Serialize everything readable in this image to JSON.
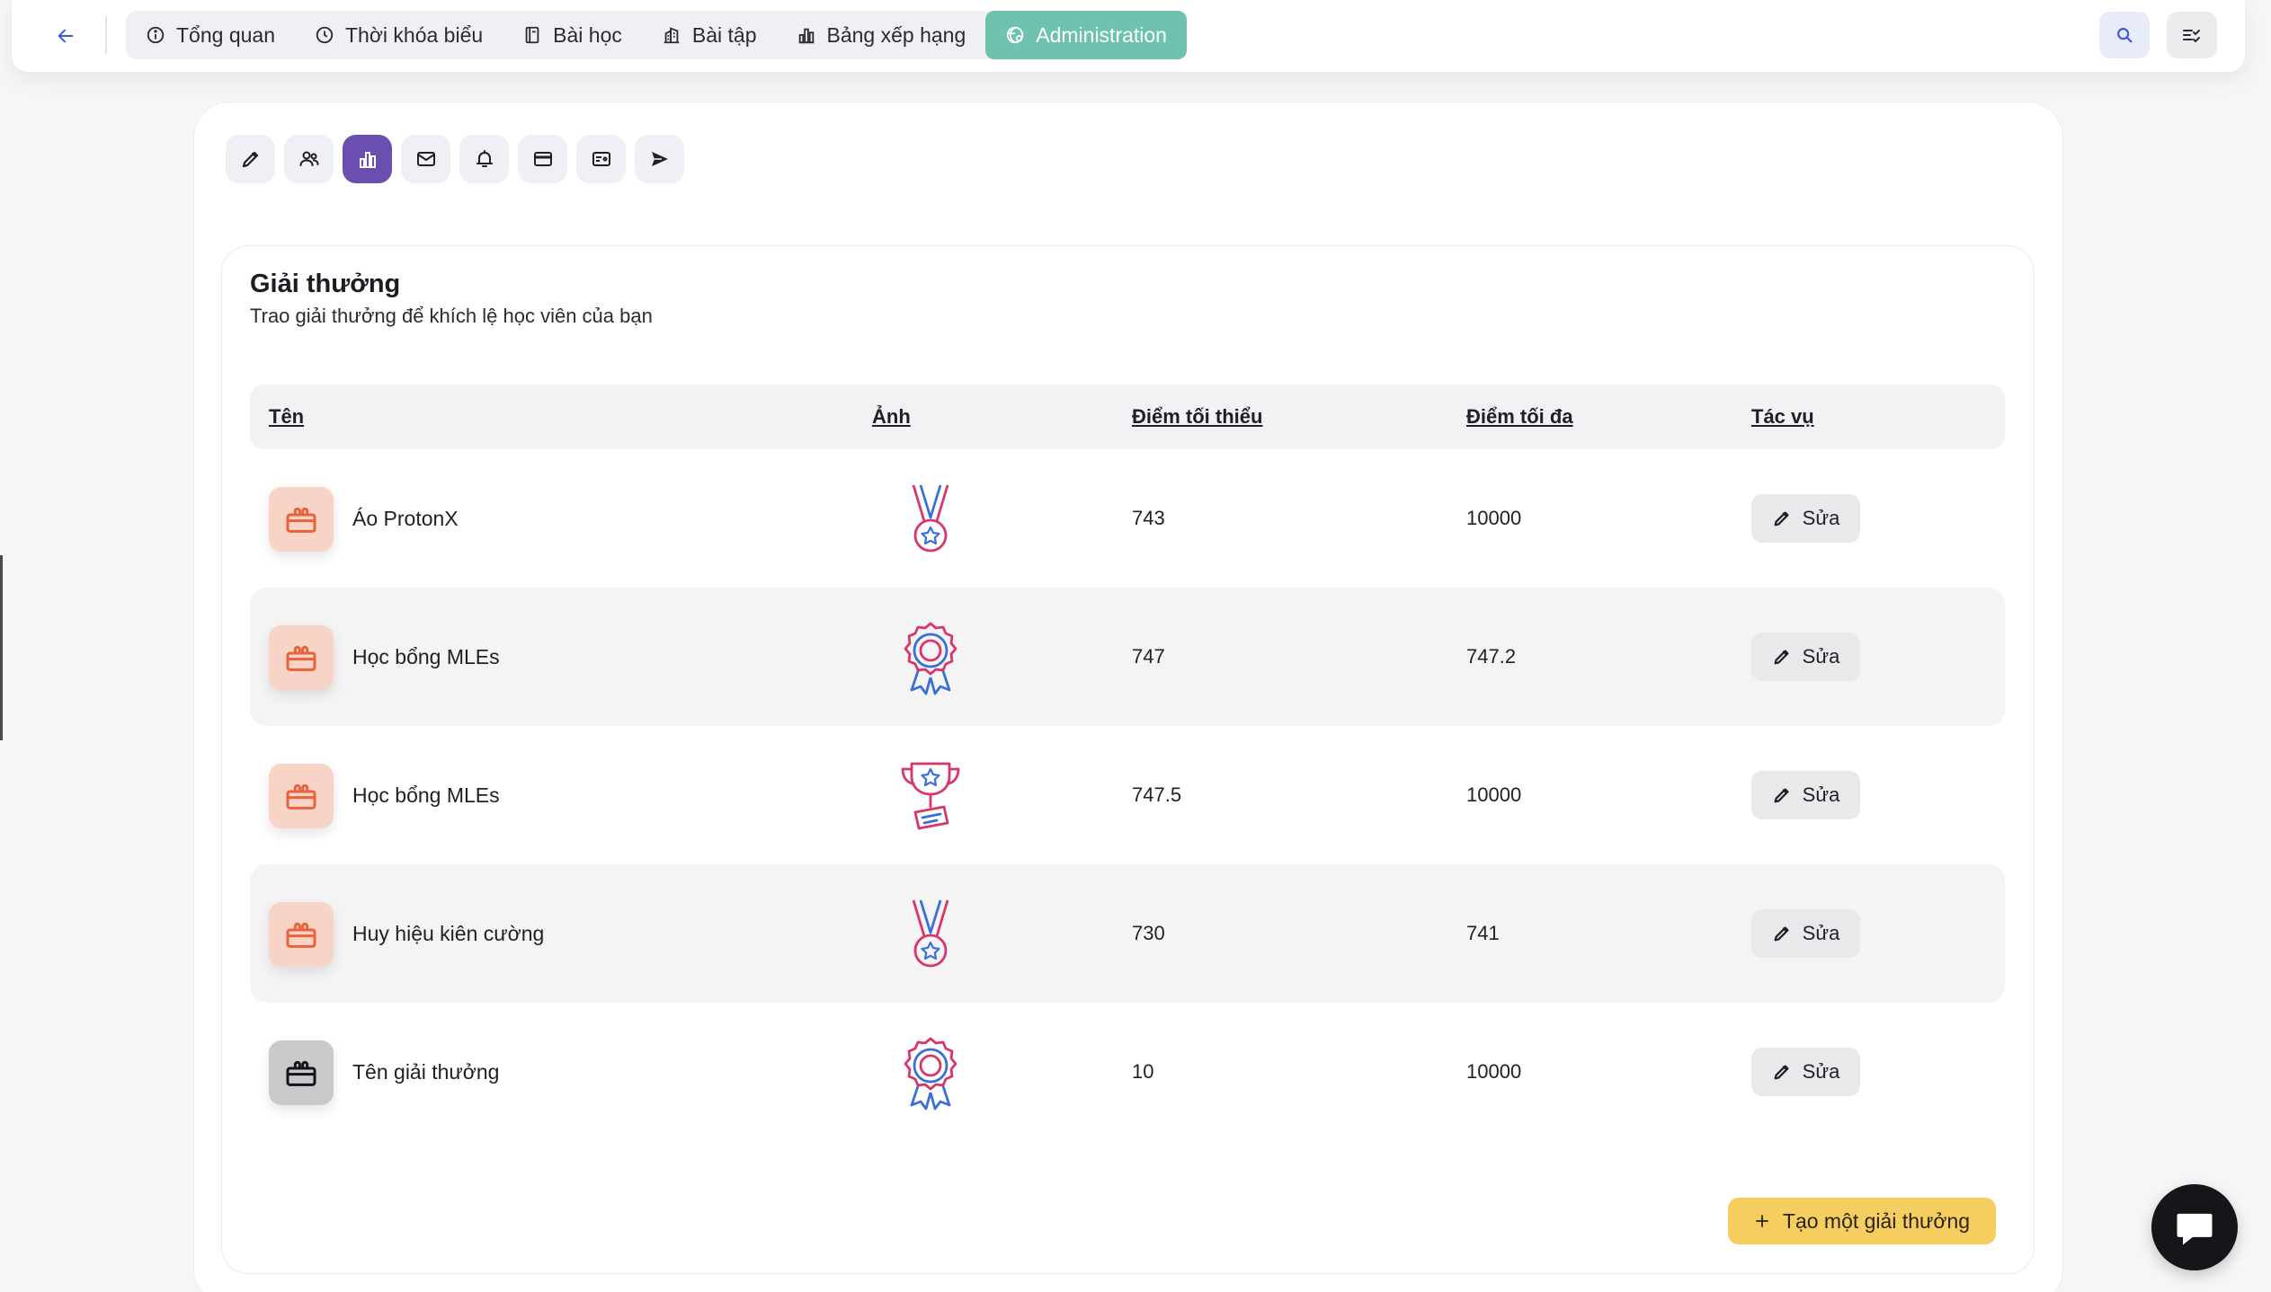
{
  "nav": {
    "tabs": [
      {
        "label": "Tổng quan",
        "icon": "info-icon"
      },
      {
        "label": "Thời khóa biểu",
        "icon": "clock-icon"
      },
      {
        "label": "Bài học",
        "icon": "book-icon"
      },
      {
        "label": "Bài tập",
        "icon": "building-icon"
      },
      {
        "label": "Bảng xếp hạng",
        "icon": "chart-bars-icon"
      },
      {
        "label": "Administration",
        "icon": "admin-icon",
        "active": true
      }
    ]
  },
  "toolbar": {
    "items": [
      "pencil-icon",
      "users-icon",
      "leaderboard-icon",
      "mail-icon",
      "bell-icon",
      "card-icon",
      "id-card-icon",
      "send-icon"
    ],
    "active_index": 2
  },
  "rewards": {
    "title": "Giải thưởng",
    "subtitle": "Trao giải thưởng để khích lệ học viên của bạn",
    "columns": {
      "name": "Tên",
      "image": "Ảnh",
      "min": "Điểm tối thiểu",
      "max": "Điểm tối đa",
      "actions": "Tác vụ"
    },
    "rows": [
      {
        "name": "Áo ProtonX",
        "image": "medal-icon",
        "min": "743",
        "max": "10000",
        "action": "Sửa"
      },
      {
        "name": "Học bổng MLEs",
        "image": "rosette-icon",
        "min": "747",
        "max": "747.2",
        "action": "Sửa"
      },
      {
        "name": "Học bổng MLEs",
        "image": "trophy-icon",
        "min": "747.5",
        "max": "10000",
        "action": "Sửa"
      },
      {
        "name": "Huy hiệu kiên cường",
        "image": "medal-icon",
        "min": "730",
        "max": "741",
        "action": "Sửa"
      },
      {
        "name": "Tên giải thưởng",
        "image": "rosette-icon",
        "min": "10",
        "max": "10000",
        "action": "Sửa"
      }
    ],
    "create_label": "Tạo một giải thưởng"
  },
  "colors": {
    "active_tab": "#6fc3ae",
    "active_tool": "#6a4eb0",
    "create_button": "#f6cd5f",
    "reward_icon_bg": "#f8d4c6",
    "reward_icon_fg": "#e8623c"
  }
}
